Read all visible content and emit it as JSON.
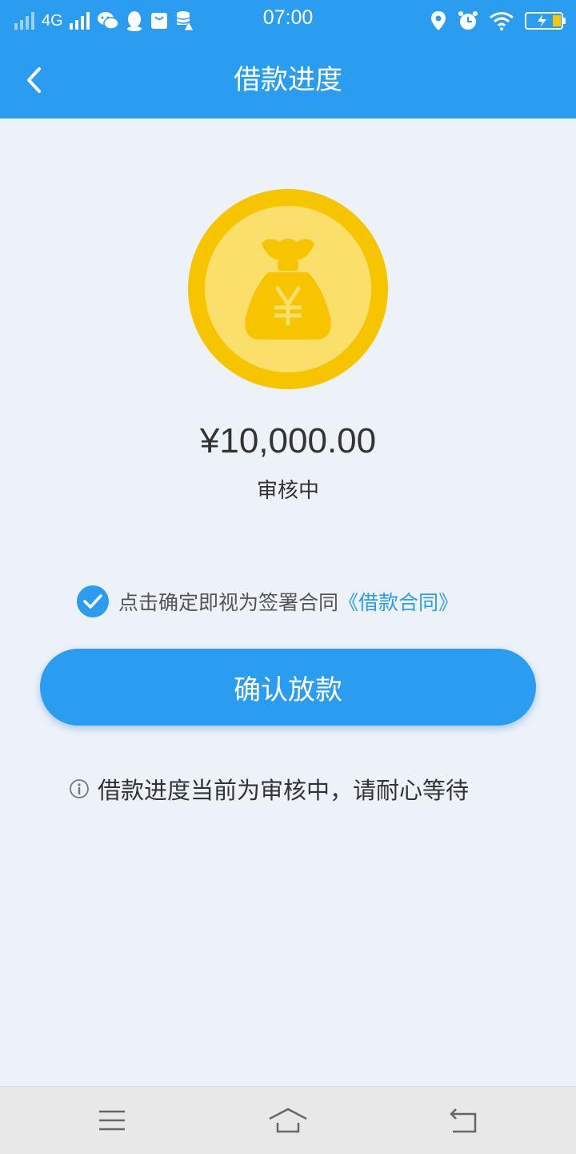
{
  "status_bar": {
    "network": "4G",
    "time": "07:00",
    "icons": [
      "signal-icon",
      "signal-full-icon",
      "wechat-icon",
      "qq-icon",
      "shopping-bag-icon",
      "storage-warning-icon",
      "location-icon",
      "alarm-icon",
      "wifi-icon",
      "battery-charging-icon"
    ]
  },
  "header": {
    "title": "借款进度",
    "back_icon": "chevron-left-icon"
  },
  "loan": {
    "icon": "money-bag-coin-icon",
    "amount": "¥10,000.00",
    "status": "审核中"
  },
  "agreement": {
    "checked": true,
    "text": "点击确定即视为签署合同",
    "link": "《借款合同》"
  },
  "confirm_button": {
    "label": "确认放款"
  },
  "notice": {
    "icon": "info-icon",
    "text": "借款进度当前为审核中，请耐心等待"
  },
  "colors": {
    "primary": "#2a9df0",
    "coin_outer": "#f7c500",
    "coin_inner": "#fae06a",
    "background": "#edf2f9"
  },
  "nav_bar": {
    "icons": [
      "menu-icon",
      "home-icon",
      "back-icon"
    ]
  }
}
